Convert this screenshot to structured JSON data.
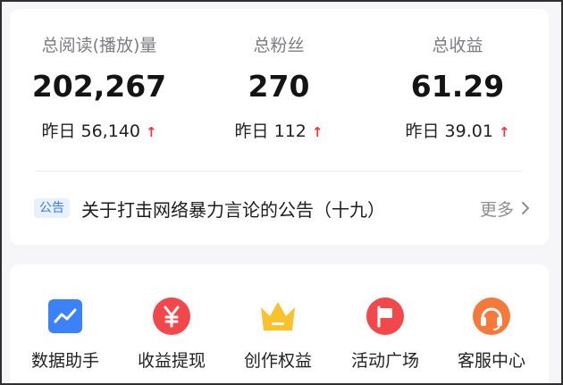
{
  "stats": [
    {
      "label": "总阅读(播放)量",
      "value": "202,267",
      "delta_label": "昨日",
      "delta_value": "56,140",
      "arrow": "↑"
    },
    {
      "label": "总粉丝",
      "value": "270",
      "delta_label": "昨日",
      "delta_value": "112",
      "arrow": "↑"
    },
    {
      "label": "总收益",
      "value": "61.29",
      "delta_label": "昨日",
      "delta_value": "39.01",
      "arrow": "↑"
    }
  ],
  "notice": {
    "tag": "公告",
    "text": "关于打击网络暴力言论的公告（十九）",
    "more": "更多"
  },
  "tools": [
    {
      "label": "数据助手",
      "icon": "chart-icon",
      "color": "#3b82f6"
    },
    {
      "label": "收益提现",
      "icon": "yuan-icon",
      "color": "#f2484b"
    },
    {
      "label": "创作权益",
      "icon": "crown-icon",
      "color": "#f8c22c"
    },
    {
      "label": "活动广场",
      "icon": "flag-icon",
      "color": "#f2484b"
    },
    {
      "label": "客服中心",
      "icon": "headset-icon",
      "color": "#f5793a"
    }
  ],
  "colors": {
    "accent_red": "#f0363b",
    "tag_blue": "#3a7bf0"
  }
}
